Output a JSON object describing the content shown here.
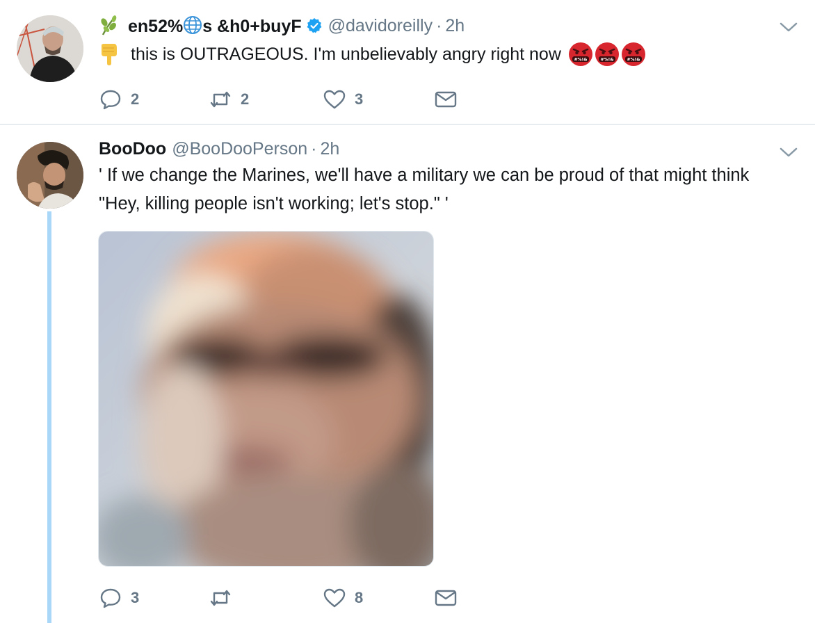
{
  "tweets": [
    {
      "display_name_part1": "en52%",
      "display_name_part2": "s &h0+buyF",
      "handle": "@davidoreilly",
      "dot": "·",
      "time": "2h",
      "text": "this is OUTRAGEOUS. I'm unbelievably angry right now",
      "emoji": [
        "sprout-icon",
        "globe-icon",
        "pointing-down-hand-icon",
        "angry-face-with-symbols-icon"
      ],
      "verified": true,
      "actions": {
        "replies": "2",
        "retweets": "2",
        "likes": "3"
      }
    },
    {
      "display_name": "BooDoo",
      "handle": "@BooDooPerson",
      "dot": "·",
      "time": "2h",
      "text": "' If we change the Marines, we'll have a military we can be proud of that might think \"Hey, killing people isn't working; let's stop.\" '",
      "actions": {
        "replies": "3",
        "retweets": "",
        "likes": "8"
      }
    }
  ],
  "colors": {
    "text": "#14171a",
    "secondary": "#657786",
    "verified": "#1da1f2",
    "thread_line": "#a9d7f7",
    "divider": "#e6ecf0"
  }
}
